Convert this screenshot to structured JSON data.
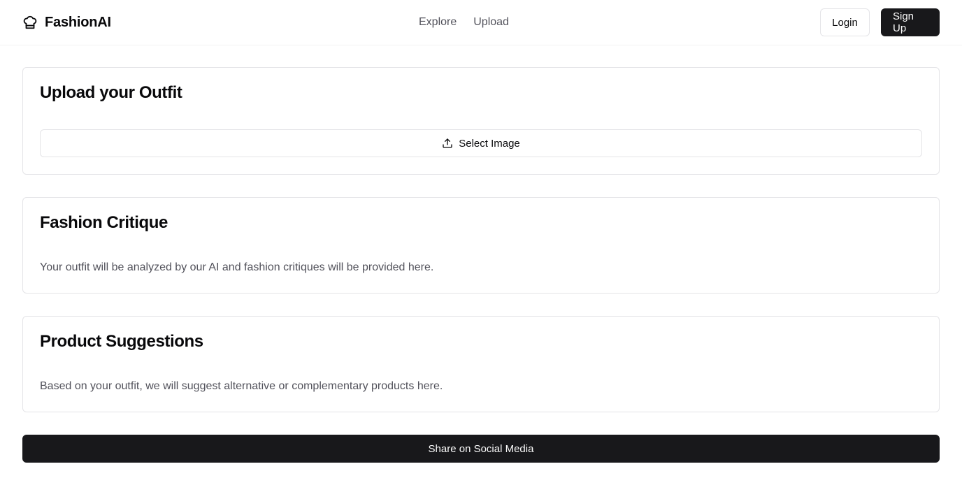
{
  "header": {
    "brand_name": "FashionAI",
    "brand_icon": "chef-hat-icon",
    "nav": [
      {
        "label": "Explore"
      },
      {
        "label": "Upload"
      }
    ],
    "login_label": "Login",
    "signup_label": "Sign Up"
  },
  "upload": {
    "title": "Upload your Outfit",
    "select_label": "Select Image",
    "select_icon": "upload-icon"
  },
  "critique": {
    "title": "Fashion Critique",
    "text": "Your outfit will be analyzed by our AI and fashion critiques will be provided here."
  },
  "suggestions": {
    "title": "Product Suggestions",
    "text": "Based on your outfit, we will suggest alternative or complementary products here."
  },
  "share_label": "Share on Social Media",
  "colors": {
    "primary": "#18181b",
    "border": "#e4e4e7",
    "muted_text": "#52525b"
  }
}
